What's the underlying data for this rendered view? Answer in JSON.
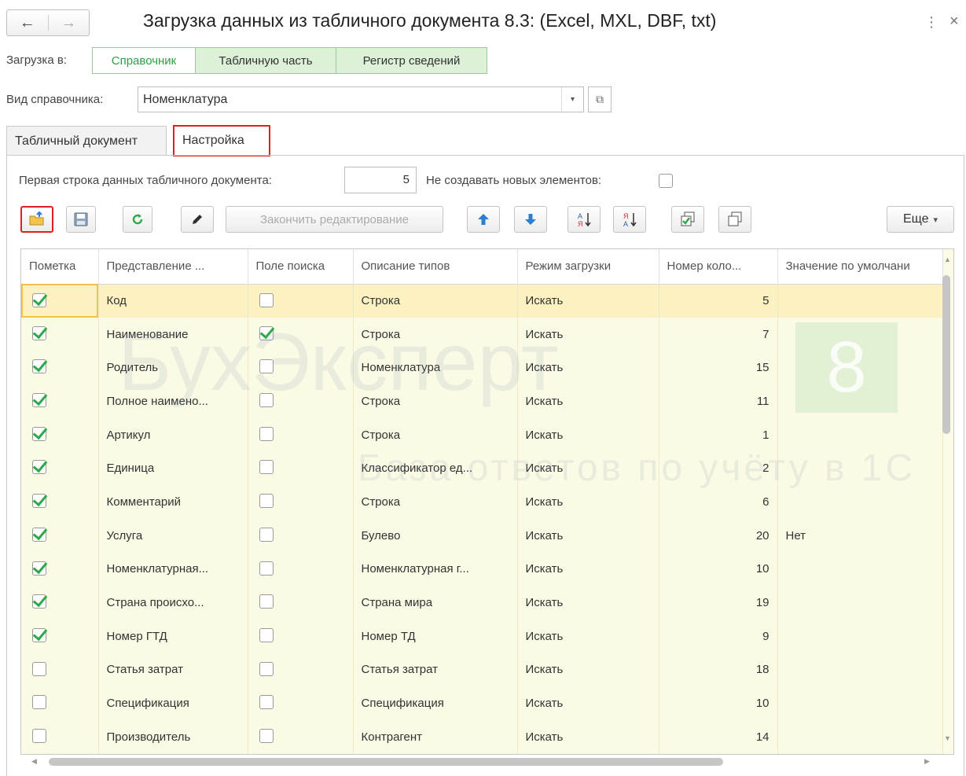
{
  "window": {
    "title": "Загрузка данных из табличного документа 8.3: (Excel, MXL, DBF, txt)",
    "back_icon": "←",
    "forward_icon": "→",
    "more_icon": "⋮",
    "close_icon": "×"
  },
  "load_into": {
    "label": "Загрузка в:",
    "options": [
      "Справочник",
      "Табличную часть",
      "Регистр сведений"
    ],
    "selected": "Справочник"
  },
  "catalog_type": {
    "label": "Вид справочника:",
    "value": "Номенклатура",
    "dropdown_icon": "▾",
    "open_icon": "⧉"
  },
  "tabs": [
    "Табличный документ",
    "Настройка"
  ],
  "settings": {
    "first_row_label": "Первая строка данных табличного документа:",
    "first_row_value": "5",
    "no_new_label": "Не создавать новых элементов:",
    "no_new_checked": false
  },
  "toolbar": {
    "finish_edit_label": "Закончить редактирование",
    "more_label": "Еще",
    "more_arrow": "▾"
  },
  "table": {
    "columns": [
      "Пометка",
      "Представление ...",
      "Поле поиска",
      "Описание типов",
      "Режим загрузки",
      "Номер коло...",
      "Значение по умолчани"
    ],
    "rows": [
      {
        "mark": true,
        "name": "Код",
        "search": false,
        "type": "Строка",
        "mode": "Искать",
        "col": "5",
        "default": ""
      },
      {
        "mark": true,
        "name": "Наименование",
        "search": true,
        "type": "Строка",
        "mode": "Искать",
        "col": "7",
        "default": ""
      },
      {
        "mark": true,
        "name": "Родитель",
        "search": false,
        "type": "Номенклатура",
        "mode": "Искать",
        "col": "15",
        "default": ""
      },
      {
        "mark": true,
        "name": "Полное наимено...",
        "search": false,
        "type": "Строка",
        "mode": "Искать",
        "col": "11",
        "default": ""
      },
      {
        "mark": true,
        "name": "Артикул",
        "search": false,
        "type": "Строка",
        "mode": "Искать",
        "col": "1",
        "default": ""
      },
      {
        "mark": true,
        "name": "Единица",
        "search": false,
        "type": "Классификатор ед...",
        "mode": "Искать",
        "col": "2",
        "default": ""
      },
      {
        "mark": true,
        "name": "Комментарий",
        "search": false,
        "type": "Строка",
        "mode": "Искать",
        "col": "6",
        "default": ""
      },
      {
        "mark": true,
        "name": "Услуга",
        "search": false,
        "type": "Булево",
        "mode": "Искать",
        "col": "20",
        "default": "Нет"
      },
      {
        "mark": true,
        "name": "Номенклатурная...",
        "search": false,
        "type": "Номенклатурная г...",
        "mode": "Искать",
        "col": "10",
        "default": ""
      },
      {
        "mark": true,
        "name": "Страна происхо...",
        "search": false,
        "type": "Страна мира",
        "mode": "Искать",
        "col": "19",
        "default": ""
      },
      {
        "mark": true,
        "name": "Номер ГТД",
        "search": false,
        "type": "Номер ТД",
        "mode": "Искать",
        "col": "9",
        "default": ""
      },
      {
        "mark": false,
        "name": "Статья затрат",
        "search": false,
        "type": "Статья затрат",
        "mode": "Искать",
        "col": "18",
        "default": ""
      },
      {
        "mark": false,
        "name": "Спецификация",
        "search": false,
        "type": "Спецификация",
        "mode": "Искать",
        "col": "10",
        "default": ""
      },
      {
        "mark": false,
        "name": "Производитель",
        "search": false,
        "type": "Контрагент",
        "mode": "Искать",
        "col": "14",
        "default": ""
      }
    ]
  },
  "watermark": {
    "brand": "БухЭксперт",
    "brand_digit": "8",
    "tagline": "База ответов по учёту в 1С"
  },
  "colors": {
    "accent_green": "#2da94a",
    "highlight_red": "#e02020",
    "row_bg": "#fafae5",
    "selected_row_bg": "#fbf1c1"
  }
}
